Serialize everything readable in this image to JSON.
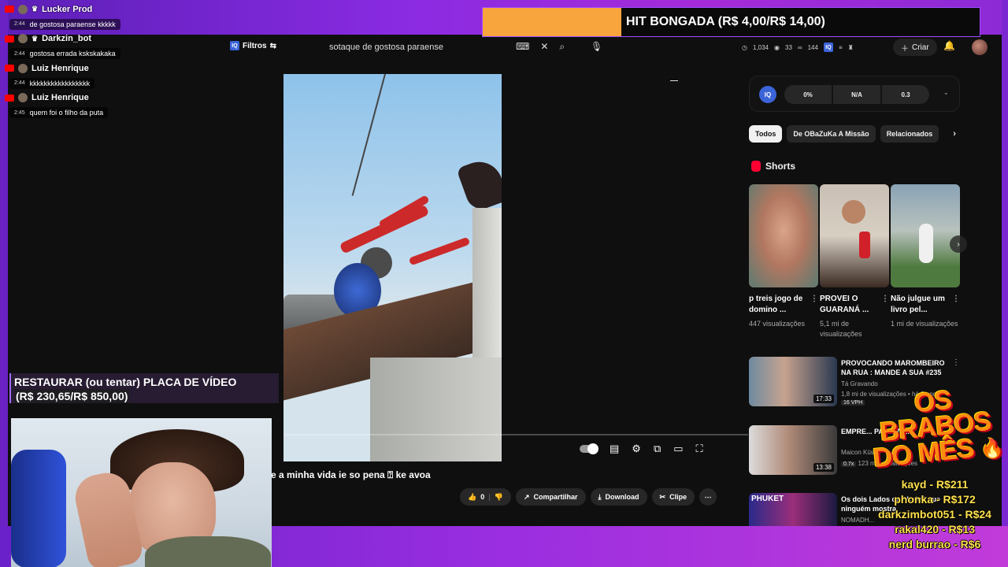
{
  "hit_banner": {
    "text": "HIT BONGADA (R$ 4,00/R$ 14,00)"
  },
  "chat": [
    {
      "user": "Lucker Prod",
      "time": "2:44",
      "message": "de gostosa paraense kkkkk"
    },
    {
      "user": "Darkzin_bot",
      "time": "2:44",
      "message": "gostosa errada kskskakaka"
    },
    {
      "user": "Luiz Henrique",
      "time": "2:44",
      "message": "kkkkkkkkkkkkkkkkk"
    },
    {
      "user": "Luiz Henrique",
      "time": "2:45",
      "message": "quem foi o filho da puta"
    }
  ],
  "topbar": {
    "filters_label": "Filtros",
    "iq_label": "IQ",
    "search_value": "sotaque de gostosa paraense",
    "stats": [
      "1,034",
      "33",
      "144"
    ],
    "create_label": "Criar"
  },
  "iq_panel": {
    "badge": "IQ",
    "values": [
      "0%",
      "N/A",
      "0.3"
    ]
  },
  "chips": [
    "Todos",
    "De OBaZuKa A Missão",
    "Relacionados"
  ],
  "shorts": {
    "heading": "Shorts",
    "items": [
      {
        "title": "p treis jogo de domino ...",
        "views": "447 visualizações"
      },
      {
        "title": "PROVEI O GUARANÁ ...",
        "views": "5,1 mi de visualizações"
      },
      {
        "title": "Não julgue um livro pel...",
        "views": "1 mi de visualizações"
      }
    ]
  },
  "recommendations": [
    {
      "title": "PROVOCANDO MAROMBEIRO NA RUA : MANDE A SUA #235",
      "channel": "Tá Gravando",
      "meta": "1,8 mi de visualizações • há 3 anos",
      "badge": "16 VPH",
      "duration": "17:33"
    },
    {
      "title": "EMPRE... PAGA 70...",
      "channel": "Maicon Küster",
      "meta": "123 mil visualizações",
      "badge": "0.7x",
      "duration": "13:38"
    },
    {
      "title": "Os dois Lados de Phuket que ninguém mostra",
      "channel": "NOMADH...",
      "meta": "",
      "badge": "",
      "duration": ""
    }
  ],
  "video": {
    "title": "e a minha vida ie so pena ⍰ ke avoa"
  },
  "actions": {
    "likes": "0",
    "share": "Compartilhar",
    "download": "Download",
    "clip": "Clipe"
  },
  "goal_overlay": {
    "line1": "RESTAURAR (ou tentar) PLACA DE VÍDEO",
    "line2": "(R$ 230,65/R$ 850,00)"
  },
  "brabos": {
    "title_line1": "OS",
    "title_line2": "BRABOS",
    "title_line3": "DO MÊS",
    "donors": [
      "kayd - R$211",
      "phonka - R$172",
      "darkzimbot051 - R$24",
      "rakal420 - R$13",
      "nerd burrao - R$6"
    ]
  },
  "rec_thumb_labels": {
    "phuket": "PHUKET"
  },
  "colors": {
    "youtube_red": "#ff0000",
    "frame_purple": "#8a2be2",
    "banner_orange": "#f7a53c",
    "donor_yellow": "#ffe14d"
  }
}
